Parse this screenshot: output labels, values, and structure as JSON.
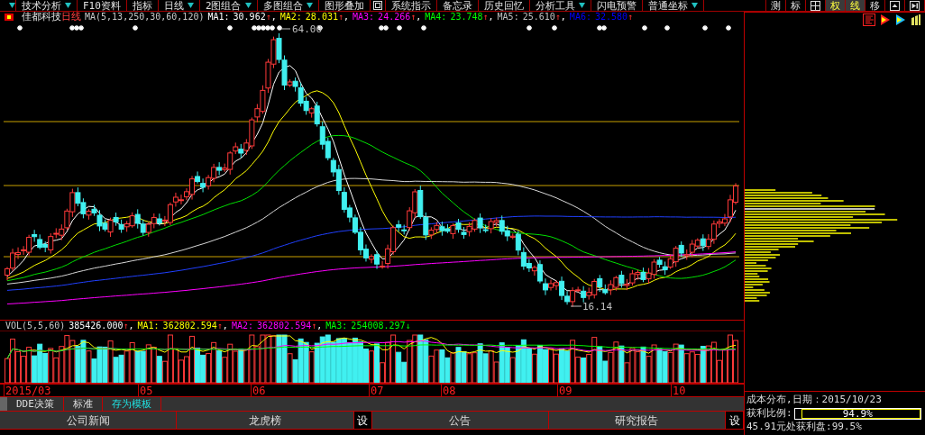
{
  "toolbar": {
    "items": [
      {
        "kind": "caret"
      },
      {
        "kind": "button",
        "label": "技术分析",
        "menu": true
      },
      {
        "kind": "button",
        "label": "F10资料",
        "menu": false
      },
      {
        "kind": "button",
        "label": "指标",
        "menu": false
      },
      {
        "kind": "button",
        "label": "日线",
        "menu": true
      },
      {
        "kind": "button",
        "label": "2图组合",
        "menu": true
      },
      {
        "kind": "button",
        "label": "多图组合",
        "menu": true
      },
      {
        "kind": "button",
        "label": "图形叠加",
        "menu": false
      },
      {
        "kind": "frame"
      },
      {
        "kind": "button",
        "label": "系统指示",
        "menu": false
      },
      {
        "kind": "button",
        "label": "备忘录",
        "menu": false
      },
      {
        "kind": "button",
        "label": "历史回忆",
        "menu": false
      },
      {
        "kind": "button",
        "label": "分析工具",
        "menu": true
      },
      {
        "kind": "button",
        "label": "闪电预警",
        "menu": false
      },
      {
        "kind": "button",
        "label": "普通坐标",
        "menu": true
      }
    ],
    "tools": [
      {
        "kind": "text",
        "label": "测",
        "selected": false
      },
      {
        "kind": "text",
        "label": "标",
        "selected": false
      },
      {
        "kind": "grid",
        "selected": false
      },
      {
        "kind": "text",
        "label": "权",
        "selected": true
      },
      {
        "kind": "text",
        "label": "线",
        "selected": true
      },
      {
        "kind": "text",
        "label": "移",
        "selected": false
      },
      {
        "kind": "up",
        "selected": false
      },
      {
        "kind": "end",
        "selected": false
      }
    ]
  },
  "chart": {
    "stock": "佳都科技",
    "period": "日线",
    "indicator": "MA(5,13,250,30,60,120)",
    "ma": [
      {
        "name": "MA1:",
        "value": "30.962",
        "arrow": "↑",
        "rising": true,
        "color": "#ffffff",
        "separator": ","
      },
      {
        "name": "MA2:",
        "value": "28.031",
        "arrow": "↑",
        "rising": true,
        "color": "#ffff00",
        "separator": ","
      },
      {
        "name": "MA3:",
        "value": "24.266",
        "arrow": "↑",
        "rising": true,
        "color": "#ff00ff",
        "separator": ","
      },
      {
        "name": "MA4:",
        "value": "23.748",
        "arrow": "↑",
        "rising": true,
        "color": "#00ff00",
        "separator": ","
      },
      {
        "name": "MA5:",
        "value": "25.610",
        "arrow": "↑",
        "rising": true,
        "color": "#c0c0c0",
        "separator": ","
      },
      {
        "name": "MA6:",
        "value": "32.580",
        "arrow": "↑",
        "rising": true,
        "color": "#0000ff"
      }
    ],
    "high_label": "64.00",
    "low_label": "16.14"
  },
  "volume": {
    "indicator": "VOL(5,5,60)",
    "value": "385426.000",
    "arrow": "↑",
    "rising": true,
    "separator": ",",
    "ma": [
      {
        "name": "MA1:",
        "value": "362802.594",
        "arrow": "↑",
        "rising": true,
        "color": "#ffff00",
        "separator": ","
      },
      {
        "name": "MA2:",
        "value": "362802.594",
        "arrow": "↑",
        "rising": true,
        "color": "#ff00ff",
        "separator": ","
      },
      {
        "name": "MA3:",
        "value": "254008.297",
        "arrow": "↓",
        "rising": false,
        "color": "#00ff00"
      }
    ]
  },
  "x_axis": [
    "2015/03",
    "05",
    "06",
    "07",
    "08",
    "09",
    "10"
  ],
  "template_tabs": [
    {
      "label": "DDE决策",
      "selected": false
    },
    {
      "label": "标准",
      "selected": false
    },
    {
      "label": "存为模板",
      "selected": true
    }
  ],
  "news_tabs": [
    {
      "kind": "tab",
      "label": "公司新闻"
    },
    {
      "kind": "tab",
      "label": "龙虎榜"
    },
    {
      "kind": "settings",
      "label": "设"
    },
    {
      "kind": "tab",
      "label": "公告"
    },
    {
      "kind": "tab",
      "label": "研究报告"
    },
    {
      "kind": "settings",
      "label": "设"
    }
  ],
  "cost_panel": {
    "title": "成本分布,日期：2015/10/23",
    "profit_label": "获利比例:",
    "profit_value": "94.9%",
    "level": 0.949,
    "profit_line": "45.91元处获利盘:99.5%"
  }
}
